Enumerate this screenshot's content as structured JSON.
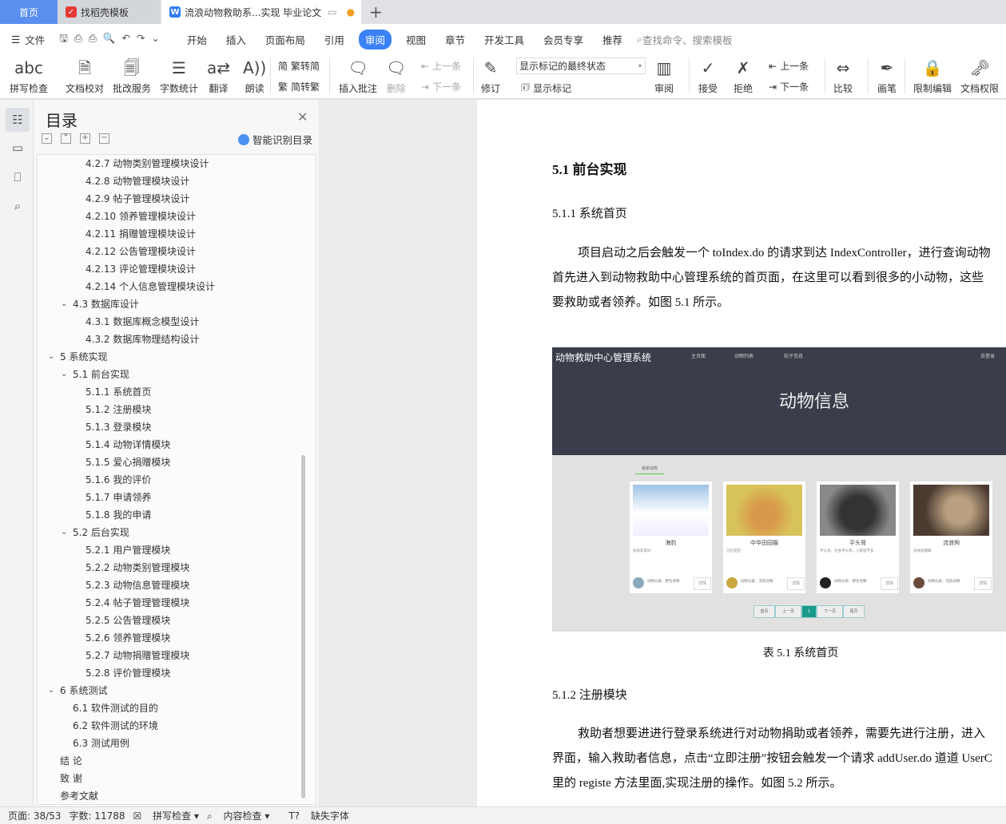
{
  "tabs": [
    {
      "label": "首页"
    },
    {
      "label": "找稻壳模板"
    },
    {
      "label": "流浪动物救助系...实现 毕业论文"
    }
  ],
  "menu": {
    "file": "文件",
    "items": [
      "开始",
      "插入",
      "页面布局",
      "引用",
      "审阅",
      "视图",
      "章节",
      "开发工具",
      "会员专享",
      "推荐"
    ],
    "active": "审阅",
    "search_placeholder": "查找命令、搜索模板"
  },
  "ribbon": {
    "spell": "拼写检查",
    "proof": "文档校对",
    "review_service": "批改服务",
    "wordcount": "字数统计",
    "translate": "翻译",
    "read": "朗读",
    "t2s": "繁转简",
    "s2t": "简转繁",
    "insert_comment": "插入批注",
    "delete": "删除",
    "prev_comment": "上一条",
    "next_comment": "下一条",
    "revise": "修订",
    "markup_state": "显示标记的最终状态",
    "show_markup": "显示标记",
    "review_pane": "审阅",
    "accept": "接受",
    "reject": "拒绝",
    "prev_change": "上一条",
    "next_change": "下一条",
    "compare": "比较",
    "pen": "画笔",
    "restrict": "限制编辑",
    "permission": "文档权限"
  },
  "toc": {
    "title": "目录",
    "smart": "智能识别目录",
    "items": [
      {
        "t": "4.2.7 动物类别管理模块设计",
        "l": 3
      },
      {
        "t": "4.2.8 动物管理模块设计",
        "l": 3
      },
      {
        "t": "4.2.9 帖子管理模块设计",
        "l": 3
      },
      {
        "t": "4.2.10 领养管理模块设计",
        "l": 3
      },
      {
        "t": "4.2.11 捐赠管理模块设计",
        "l": 3
      },
      {
        "t": "4.2.12 公告管理模块设计",
        "l": 3
      },
      {
        "t": "4.2.13 评论管理模块设计",
        "l": 3
      },
      {
        "t": "4.2.14 个人信息管理模块设计",
        "l": 3
      },
      {
        "t": "4.3  数据库设计",
        "l": 2,
        "c": 1
      },
      {
        "t": "4.3.1 数据库概念模型设计",
        "l": 3
      },
      {
        "t": "4.3.2 数据库物理结构设计",
        "l": 3
      },
      {
        "t": "5  系统实现",
        "l": 1,
        "c": 1
      },
      {
        "t": "5.1  前台实现",
        "l": 2,
        "c": 1
      },
      {
        "t": "5.1.1  系统首页",
        "l": 3
      },
      {
        "t": "5.1.2  注册模块",
        "l": 3
      },
      {
        "t": "5.1.3 登录模块",
        "l": 3
      },
      {
        "t": "5.1.4 动物详情模块",
        "l": 3
      },
      {
        "t": "5.1.5 爱心捐赠模块",
        "l": 3
      },
      {
        "t": "5.1.6  我的评价",
        "l": 3
      },
      {
        "t": "5.1.7  申请领养",
        "l": 3
      },
      {
        "t": "5.1.8  我的申请",
        "l": 3
      },
      {
        "t": "5.2  后台实现",
        "l": 2,
        "c": 1
      },
      {
        "t": "5.2.1  用户管理模块",
        "l": 3
      },
      {
        "t": "5.2.2  动物类别管理模块",
        "l": 3
      },
      {
        "t": "5.2.3  动物信息管理模块",
        "l": 3
      },
      {
        "t": "5.2.4  帖子管理管理模块",
        "l": 3
      },
      {
        "t": "5.2.5  公告管理模块",
        "l": 3
      },
      {
        "t": "5.2.6  领养管理模块",
        "l": 3
      },
      {
        "t": "5.2.7  动物捐赠管理模块",
        "l": 3
      },
      {
        "t": "5.2.8  评价管理模块",
        "l": 3
      },
      {
        "t": "6  系统测试",
        "l": 1,
        "c": 1
      },
      {
        "t": "6.1  软件测试的目的",
        "l": 2
      },
      {
        "t": "6.2  软件测试的环境",
        "l": 2
      },
      {
        "t": "6.3  测试用例",
        "l": 2
      },
      {
        "t": "结   论",
        "l": 1
      },
      {
        "t": "致   谢",
        "l": 1
      },
      {
        "t": "参考文献",
        "l": 1
      }
    ]
  },
  "doc": {
    "h_51": "5.1  前台实现",
    "h_511": "5.1.1  系统首页",
    "p1": [
      "项目启动之后会触发一个 toIndex.do 的请求到达 IndexController，进行查询动物",
      "首先进入到动物救助中心管理系统的首页面，在这里可以看到很多的小动物，这些",
      "要救助或者领养。如图 5.1 所示。"
    ],
    "caption": "表 5.1  系统首页",
    "h_512": "5.1.2  注册模块",
    "p2": [
      "救助者想要进进行登录系统进行对动物捐助或者领养，需要先进行注册，进入",
      "界面，输入救助者信息，点击“立即注册”按钮会触发一个请求 addUser.do 道道 UserC",
      "里的 registe 方法里面,实现注册的操作。如图 5.2 所示。"
    ],
    "figure": {
      "brand": "动物救助中心管理系统",
      "nav": [
        "主页面",
        "动物列表",
        "帖子信息"
      ],
      "login": "去登录",
      "banner": "动物信息",
      "section": "最新动物",
      "cards": [
        {
          "name": "海豹",
          "desc": "体质非常好",
          "cat": "动物分类：野生动物",
          "btn": "详情"
        },
        {
          "name": "中华田园猫",
          "desc": "已打疫苗",
          "cat": "动物分类：流浪动物",
          "btn": "详情"
        },
        {
          "name": "平头哥",
          "desc": "平头哥，社会平头哥，人狠话不多",
          "cat": "动物分类：野生动物",
          "btn": "详情"
        },
        {
          "name": "流浪狗",
          "desc": "身体很健康",
          "cat": "动物分类：流浪动物",
          "btn": "详情"
        }
      ],
      "pager": [
        "首页",
        "上一页",
        "1",
        "下一页",
        "尾页"
      ]
    }
  },
  "status": {
    "page": "页面: 38/53",
    "words": "字数: 11788",
    "spell": "拼写检查",
    "content": "内容检查",
    "font": "缺失字体"
  }
}
